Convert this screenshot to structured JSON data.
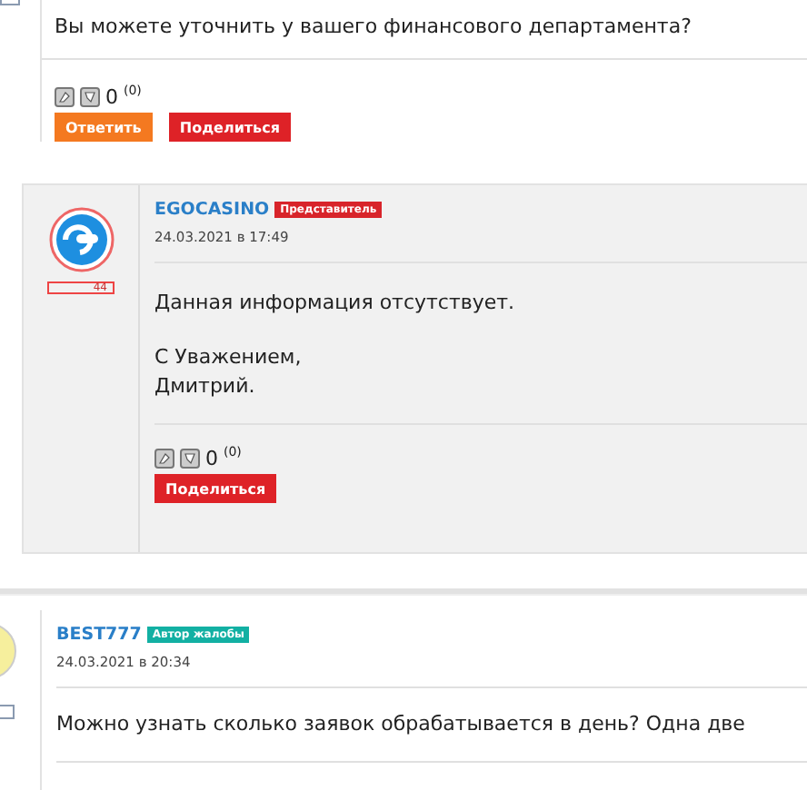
{
  "post_top": {
    "text": "Вы можете уточнить у вашего финансового департамента?",
    "votes": {
      "count": "0",
      "total": "(0)"
    },
    "buttons": [
      {
        "label": "Ответить",
        "kind": "reply"
      },
      {
        "label": "Поделиться",
        "kind": "share"
      }
    ]
  },
  "reply": {
    "author": "EGOCASINO",
    "badge": "Представитель",
    "date": "24.03.2021 в 17:49",
    "rating": "44",
    "paragraphs": [
      "Данная информация отсутствует.",
      "С Уважением,\nДмитрий."
    ],
    "votes": {
      "count": "0",
      "total": "(0)"
    },
    "buttons": [
      {
        "label": "Поделиться",
        "kind": "share"
      }
    ]
  },
  "post_next": {
    "author": "BEST777",
    "badge": "Автор жалобы",
    "date": "24.03.2021 в 20:34",
    "text": "Можно узнать сколько заявок обрабатывается в день? Одна две"
  }
}
